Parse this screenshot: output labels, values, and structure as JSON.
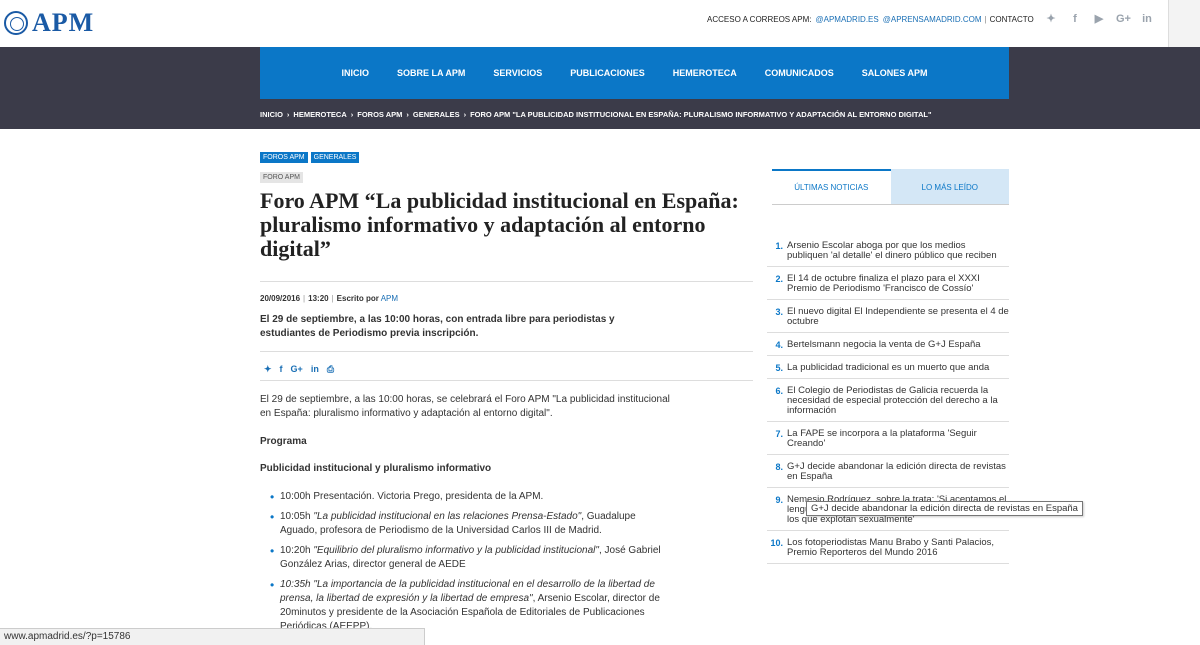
{
  "header": {
    "logo_text": "APM",
    "access_label": "ACCESO A CORREOS APM:",
    "email1": "@APMADRID.ES",
    "email2": "@APRENSAMADRID.COM",
    "contact": "CONTACTO",
    "social": [
      {
        "icon": "twitter-icon",
        "glyph": "✦"
      },
      {
        "icon": "facebook-icon",
        "glyph": "f"
      },
      {
        "icon": "youtube-icon",
        "glyph": "▶"
      },
      {
        "icon": "google-plus-icon",
        "glyph": "G+"
      },
      {
        "icon": "linkedin-icon",
        "glyph": "in"
      }
    ]
  },
  "nav": {
    "items": [
      "INICIO",
      "SOBRE LA APM",
      "SERVICIOS",
      "PUBLICACIONES",
      "HEMEROTECA",
      "COMUNICADOS",
      "SALONES APM"
    ]
  },
  "breadcrumb": [
    "INICIO",
    "HEMEROTECA",
    "FOROS APM",
    "GENERALES",
    "FORO APM \"LA PUBLICIDAD INSTITUCIONAL EN ESPAÑA: PLURALISMO INFORMATIVO Y ADAPTACIÓN AL ENTORNO DIGITAL\""
  ],
  "article": {
    "tags": [
      "FOROS APM",
      "GENERALES"
    ],
    "tag_secondary": "FORO APM",
    "title": "Foro APM “La publicidad institucional en España: pluralismo informativo y adaptación al entorno digital”",
    "date": "20/09/2016",
    "time": "13:20",
    "written_by": "Escrito por",
    "author": "APM",
    "lead": "El 29 de septiembre, a las 10:00 horas, con entrada libre para periodistas y estudiantes de Periodismo previa inscripción.",
    "share": [
      {
        "icon": "twitter-icon",
        "glyph": "✦"
      },
      {
        "icon": "facebook-icon",
        "glyph": "f"
      },
      {
        "icon": "google-plus-icon",
        "glyph": "G+"
      },
      {
        "icon": "linkedin-icon",
        "glyph": "in"
      },
      {
        "icon": "print-icon",
        "glyph": "⎙"
      }
    ],
    "intro": "El 29 de septiembre, a las 10:00 horas, se celebrará el Foro APM \"La publicidad institucional en España: pluralismo informativo y adaptación al entorno digital\".",
    "programa": "Programa",
    "subheading": "Publicidad institucional y pluralismo informativo",
    "program_items": [
      {
        "italic": "",
        "text": "10:00h Presentación. Victoria Prego, presidenta de la APM."
      },
      {
        "prefix": "10:05h ",
        "italic": "\"La publicidad institucional en las relaciones Prensa-Estado\"",
        "text": ", Guadalupe Aguado, profesora de Periodismo de la Universidad Carlos III de Madrid."
      },
      {
        "prefix": "10:20h ",
        "italic": "\"Equilibrio del pluralismo informativo y la publicidad institucional\"",
        "text": ", José Gabriel González Arias, director general de AEDE"
      },
      {
        "prefix": "",
        "italic": "10:35h \"La importancia de la publicidad institucional en el desarrollo de la libertad de prensa, la libertad de expresión y la libertad de empresa\"",
        "text": ", Arsenio Escolar, director de 20minutos y presidente de la Asociación Española de Editoriales de Publicaciones Periódicas (AEEPP)."
      }
    ]
  },
  "sidebar": {
    "tabs": [
      "ÚLTIMAS NOTICIAS",
      "LO MÁS LEÍDO"
    ],
    "news": [
      {
        "num": "1.",
        "text": "Arsenio Escolar aboga por que los medios publiquen 'al detalle' el dinero público que reciben"
      },
      {
        "num": "2.",
        "text": "El 14 de octubre finaliza el plazo para el XXXI Premio de Periodismo 'Francisco de Cossío'"
      },
      {
        "num": "3.",
        "text": "El nuevo digital El Independiente se presenta el 4 de octubre"
      },
      {
        "num": "4.",
        "text": "Bertelsmann negocia la venta de G+J España"
      },
      {
        "num": "5.",
        "text": "La publicidad tradicional es un muerto que anda"
      },
      {
        "num": "6.",
        "text": "El Colegio de Periodistas de Galicia recuerda la necesidad de especial protección del derecho a la información"
      },
      {
        "num": "7.",
        "text": "La FAPE se incorpora a la plataforma 'Seguir Creando'"
      },
      {
        "num": "8.",
        "text": "G+J decide abandonar la edición directa de revistas en España"
      },
      {
        "num": "9.",
        "text": "Nemesio Rodríguez, sobre la trata: 'Si aceptamos el lenguaje discriminatorio, nos estamos rindiendo ante los que explotan sexualmente'"
      },
      {
        "num": "10.",
        "text": "Los fotoperiodistas Manu Brabo y Santi Palacios, Premio Reporteros del Mundo 2016"
      }
    ],
    "tooltip": "G+J decide abandonar la edición directa de revistas en España"
  },
  "statusbar": {
    "url": "www.apmadrid.es/?p=15786"
  }
}
